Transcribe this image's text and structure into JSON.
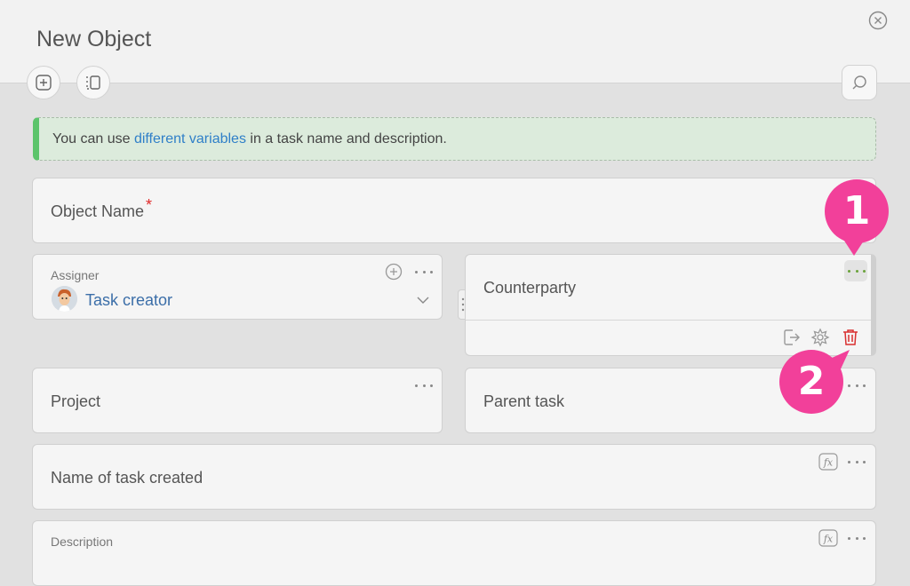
{
  "dialog": {
    "title": "New Object",
    "icons": {
      "close": "close-circle-icon",
      "add": "add-square-icon",
      "layout": "layout-panel-icon",
      "search": "search-icon"
    }
  },
  "banner": {
    "text_before": "You can use ",
    "link": "different variables",
    "text_after": " in a task name and description.",
    "accent_color": "#5cc46b",
    "link_color": "#2f7fc8"
  },
  "fields": {
    "object_name": {
      "label": "Object Name",
      "required_mark": "*"
    },
    "assigner": {
      "label": "Assigner",
      "value": "Task creator",
      "icons": [
        "add-circle-icon",
        "more-icon",
        "chevron-down-icon"
      ]
    },
    "counterparty": {
      "label": "Counterparty",
      "actions": [
        "move-out-icon",
        "settings-icon",
        "trash-icon"
      ]
    },
    "project": {
      "label": "Project"
    },
    "parent_task": {
      "label": "Parent task"
    },
    "name_of_task_created": {
      "label": "Name of task created"
    },
    "description": {
      "label": "Description"
    }
  },
  "callouts": {
    "one": "1",
    "two": "2",
    "color": "#f2409a"
  }
}
